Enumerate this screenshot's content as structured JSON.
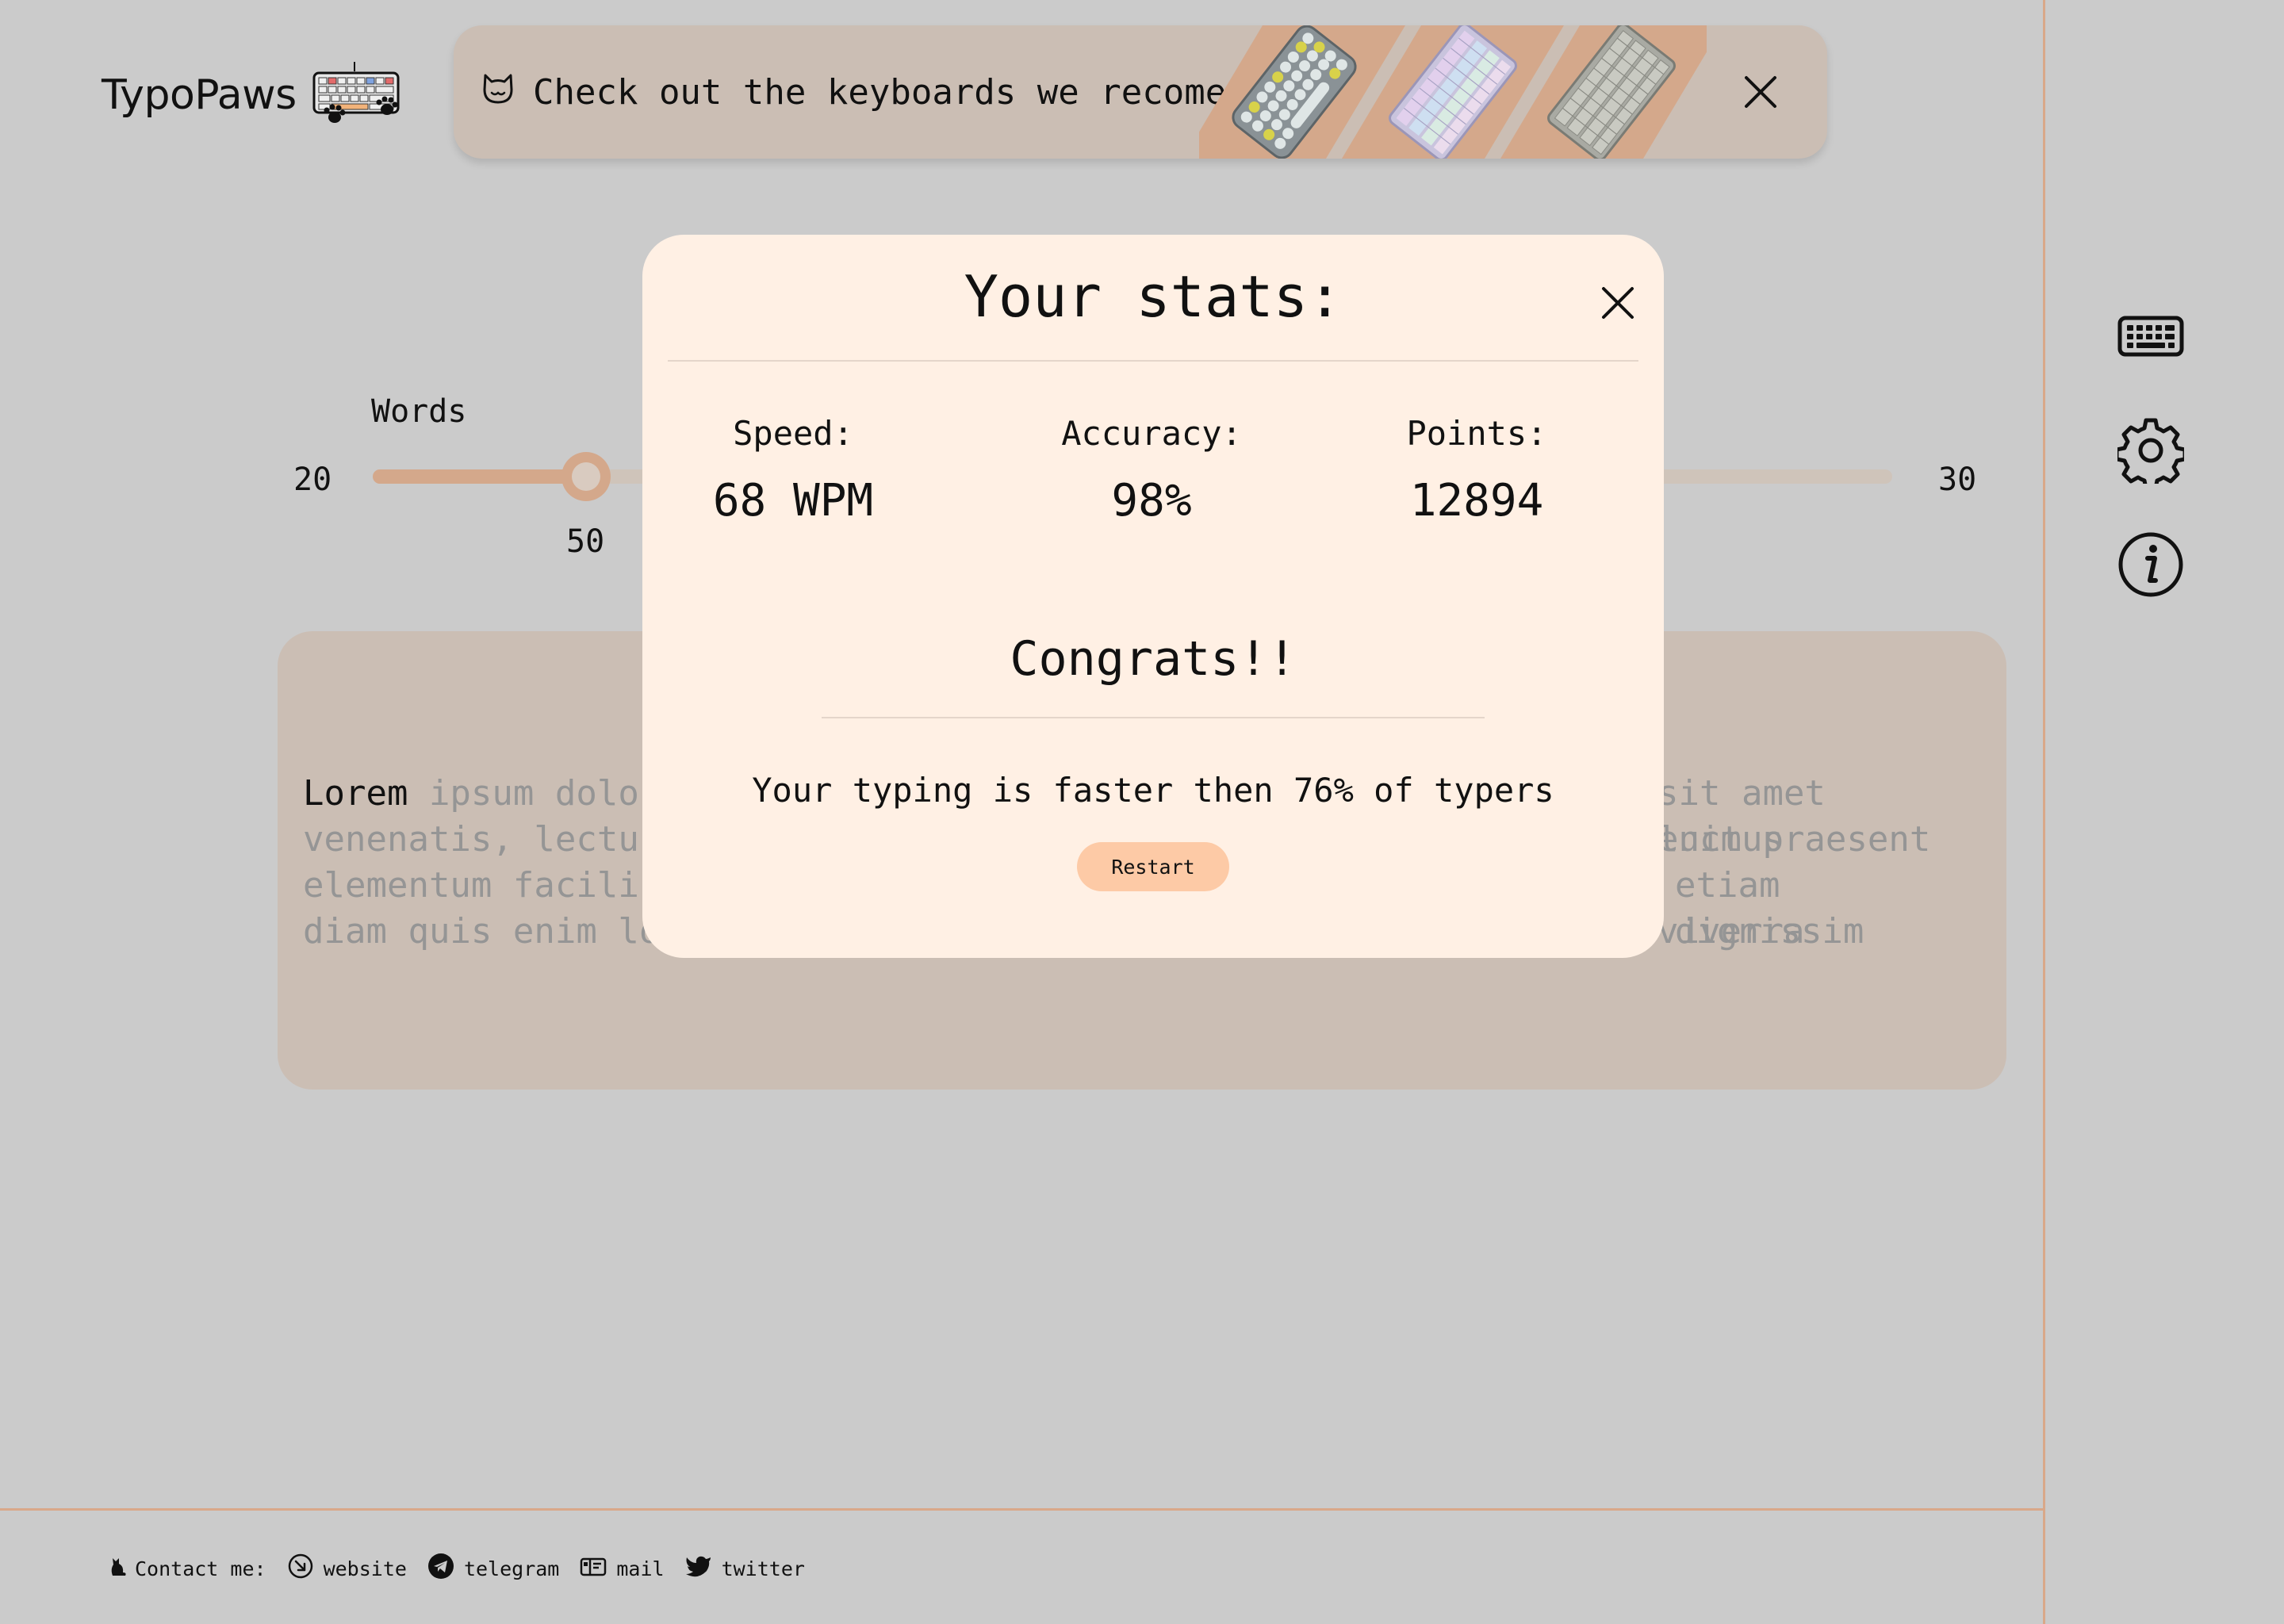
{
  "colors": {
    "page_bg": "#cbcbcb",
    "accent": "#d4a88b",
    "banner_bg": "#cbbeb4",
    "modal_bg": "#fff0e4",
    "restart_bg": "#fdcaa6",
    "divider": "#d9a889"
  },
  "header": {
    "logo_text": "TypoPaws",
    "logo_icon": "keyboard-paws-icon"
  },
  "banner": {
    "icon": "cat-icon",
    "text": "Check out the keyboards we recomend",
    "keyboards": [
      "keyboard-yellow-round-keys",
      "keyboard-pastel-rgb",
      "keyboard-grey"
    ],
    "close_icon": "close-icon"
  },
  "sidebar": {
    "items": [
      {
        "icon": "keyboard-icon"
      },
      {
        "icon": "gear-icon"
      },
      {
        "icon": "info-icon"
      }
    ]
  },
  "settings": {
    "words_label": "Words",
    "slider_min": "20",
    "slider_max": "30",
    "slider_value": "50",
    "slider_fraction": 0.14
  },
  "typing": {
    "typed": "Lorem",
    "line1_left": " ipsum dolor s",
    "line1_right": "sit amet luctus",
    "line2_left": "venenatis, lectus m",
    "line2_right": "enim praesent",
    "line3_left": "elementum facilisis",
    "line3_right": "etiam dignissim",
    "line4_left": "diam quis enim lobo",
    "line4_right": "viverra"
  },
  "modal": {
    "title": "Your stats:",
    "stats": [
      {
        "label": "Speed:",
        "value": "68 WPM"
      },
      {
        "label": "Accuracy:",
        "value": "98%"
      },
      {
        "label": "Points:",
        "value": "12894"
      }
    ],
    "congrats": "Congrats!!",
    "message": "Your typing is faster then 76% of typers",
    "restart_label": "Restart"
  },
  "footer": {
    "contact_label": "Contact me:",
    "links": [
      {
        "icon": "website-icon",
        "label": "website"
      },
      {
        "icon": "telegram-icon",
        "label": "telegram"
      },
      {
        "icon": "mail-icon",
        "label": "mail"
      },
      {
        "icon": "twitter-icon",
        "label": "twitter"
      }
    ]
  }
}
